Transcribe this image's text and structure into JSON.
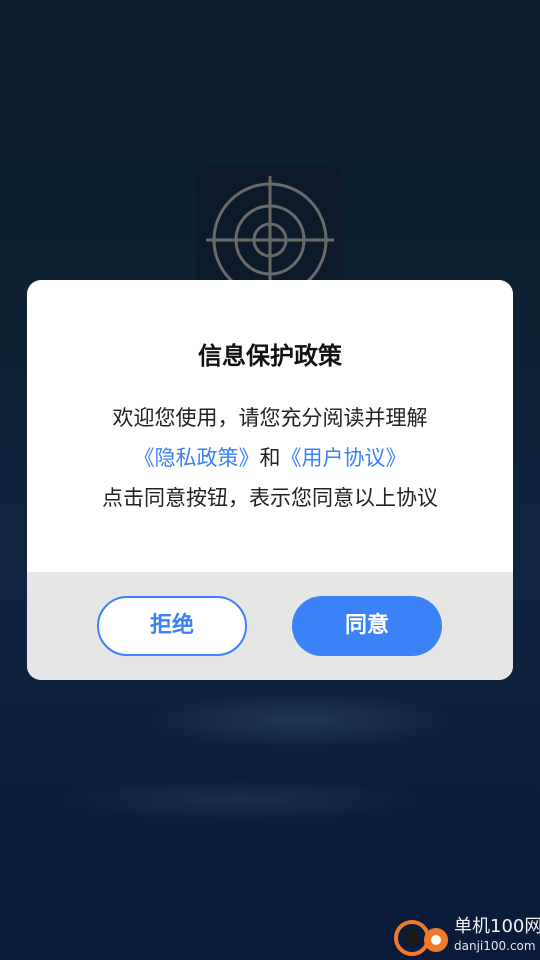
{
  "dialog": {
    "title": "信息保护政策",
    "body_line1": "欢迎您使用，请您充分阅读并理解",
    "privacy_link": "《隐私政策》",
    "conjunction": "和",
    "agreement_link": "《用户协议》",
    "body_line3": "点击同意按钮，表示您同意以上协议",
    "reject_label": "拒绝",
    "agree_label": "同意"
  },
  "app_logo": {
    "icon": "target-crosshair-icon"
  },
  "watermark": {
    "name": "单机100网",
    "domain": "danji100.com"
  },
  "colors": {
    "accent": "#3b82f6",
    "background": "#0e2236",
    "footer": "#e6e6e6"
  }
}
